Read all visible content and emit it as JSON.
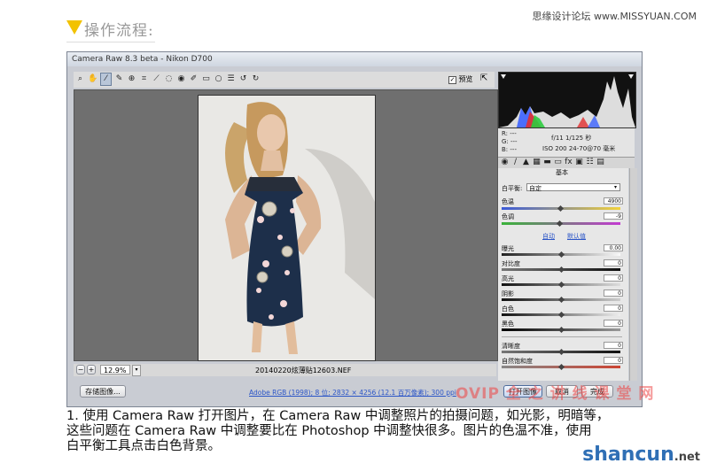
{
  "header": {
    "title": "操作流程:",
    "site": "思缘设计论坛 www.MISSYUAN.COM"
  },
  "window": {
    "title": "Camera Raw 8.3 beta - Nikon D700",
    "preview_checkbox": "预览",
    "zoom": "12.9%",
    "filename": "20140220炫薄贴12603.NEF",
    "workflow_link": "Adobe RGB (1998); 8 位; 2832 × 4256 (12.1 百万像素); 300 ppi",
    "buttons": {
      "save": "存储图像...",
      "open": "打开图像",
      "cancel": "取消",
      "done": "完成"
    }
  },
  "info": {
    "r": "R: ---",
    "g": "G: ---",
    "b": "B: ---",
    "aperture_shutter": "f/11  1/125 秒",
    "iso_lens": "ISO 200  24-70@70 毫米"
  },
  "panel": {
    "title": "基本",
    "white_balance_label": "白平衡:",
    "white_balance_value": "自定",
    "temperature_label": "色温",
    "temperature_value": "4900",
    "tint_label": "色调",
    "tint_value": "-9",
    "auto_label": "自动",
    "default_label": "默认值",
    "exposure_label": "曝光",
    "exposure_value": "0.00",
    "contrast_label": "对比度",
    "contrast_value": "0",
    "highlights_label": "高光",
    "highlights_value": "0",
    "shadows_label": "阴影",
    "shadows_value": "0",
    "whites_label": "白色",
    "whites_value": "0",
    "blacks_label": "黑色",
    "blacks_value": "0",
    "clarity_label": "清晰度",
    "clarity_value": "0",
    "vibrance_label": "自然饱和度",
    "vibrance_value": "0"
  },
  "caption": {
    "line1": "1. 使用 Camera Raw 打开图片，在 Camera Raw 中调整照片的拍摄问题，如光影，明暗等，",
    "line2": "这些问题在 Camera Raw 中调整要比在 Photoshop 中调整快很多。图片的色温不准，使用",
    "line3": "白平衡工具点击白色背景。"
  },
  "watermark": {
    "text": "OVIP 全 之 讲 线 课 堂 网"
  },
  "brand": {
    "name": "shancun",
    "tld": ".net"
  },
  "colors": {
    "accent": "#f2c200",
    "brand": "#2f6fb5"
  }
}
